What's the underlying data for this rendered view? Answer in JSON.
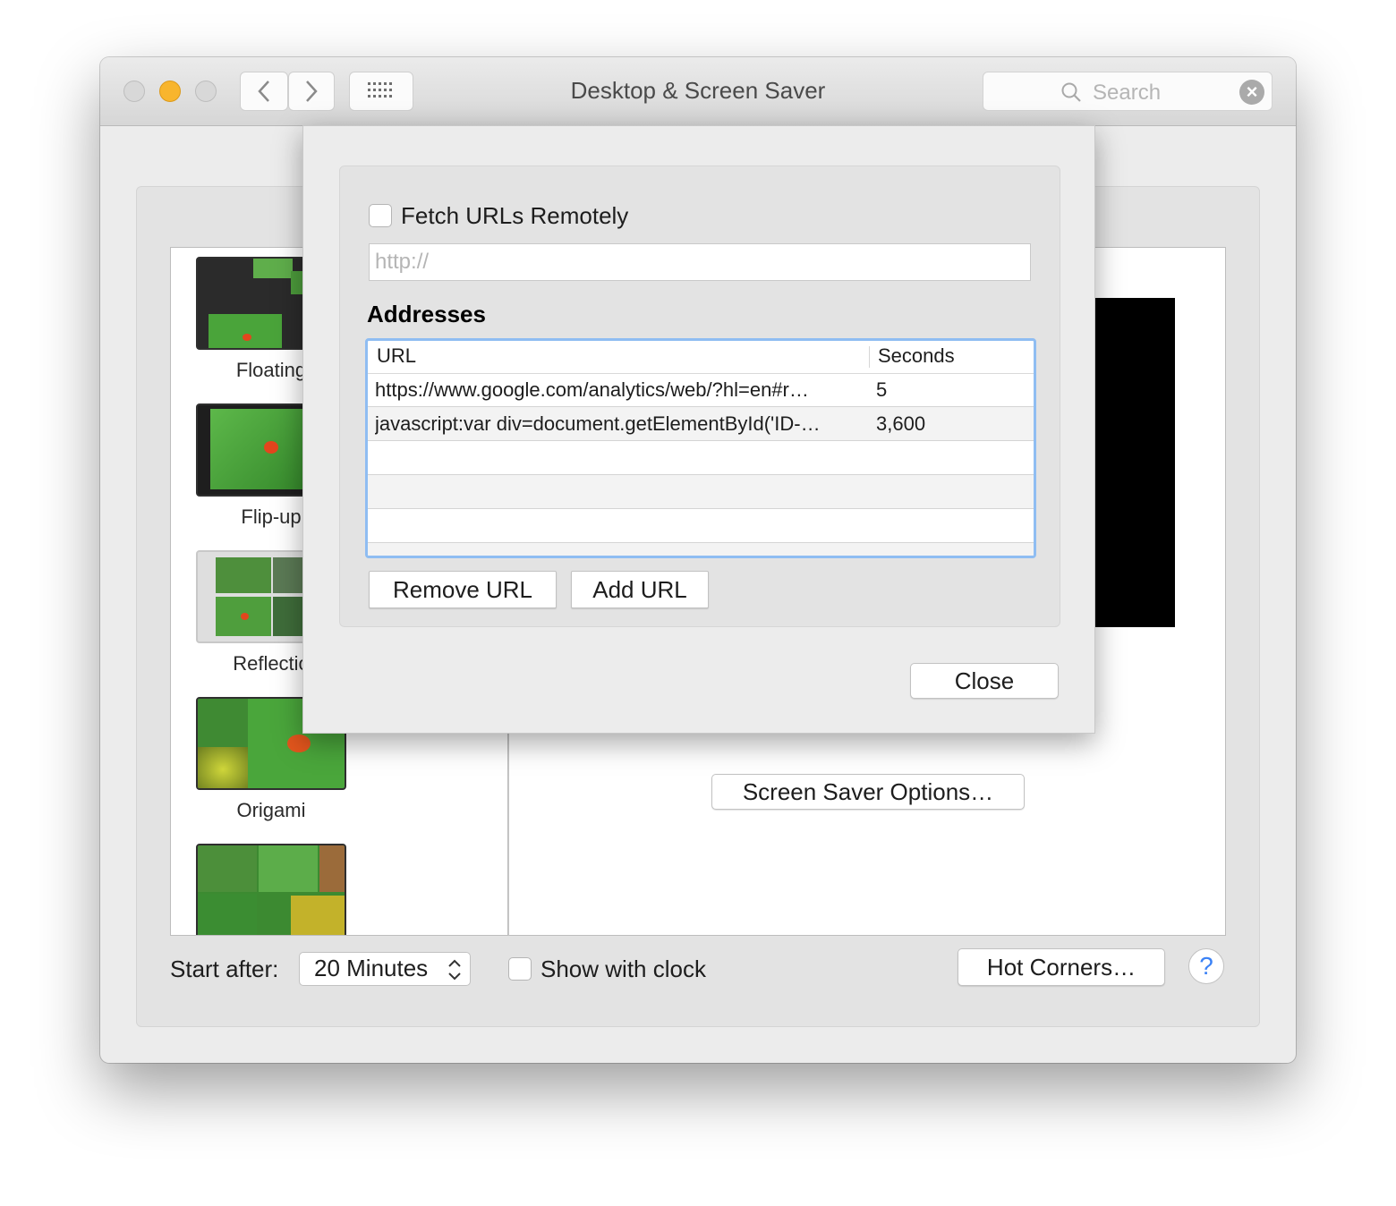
{
  "window": {
    "title": "Desktop & Screen Saver"
  },
  "search": {
    "placeholder": "Search"
  },
  "savers": [
    {
      "label": "Floating"
    },
    {
      "label": "Flip-up"
    },
    {
      "label": "Reflectio"
    },
    {
      "label": "Origami"
    },
    {
      "label": ""
    }
  ],
  "preview": {
    "options_button": "Screen Saver Options…"
  },
  "footer": {
    "start_after_label": "Start after:",
    "start_after_value": "20 Minutes",
    "show_clock_label": "Show with clock",
    "hot_corners_button": "Hot Corners…",
    "help_glyph": "?"
  },
  "sheet": {
    "fetch_label": "Fetch URLs Remotely",
    "url_placeholder": "http://",
    "addresses_title": "Addresses",
    "columns": {
      "url": "URL",
      "seconds": "Seconds"
    },
    "rows": [
      {
        "url": "https://www.google.com/analytics/web/?hl=en#r…",
        "seconds": "5"
      },
      {
        "url": "javascript:var div=document.getElementById('ID-…",
        "seconds": "3,600"
      }
    ],
    "remove_button": "Remove URL",
    "add_button": "Add URL",
    "close_button": "Close"
  },
  "colors": {
    "accent_focus": "#8fbdf2",
    "traffic_yellow": "#f8b52d",
    "help_blue": "#3b82f6"
  },
  "icons": [
    "back-chevron-icon",
    "forward-chevron-icon",
    "grid-icon",
    "search-icon",
    "clear-icon",
    "stepper-arrows-icon",
    "help-icon"
  ]
}
